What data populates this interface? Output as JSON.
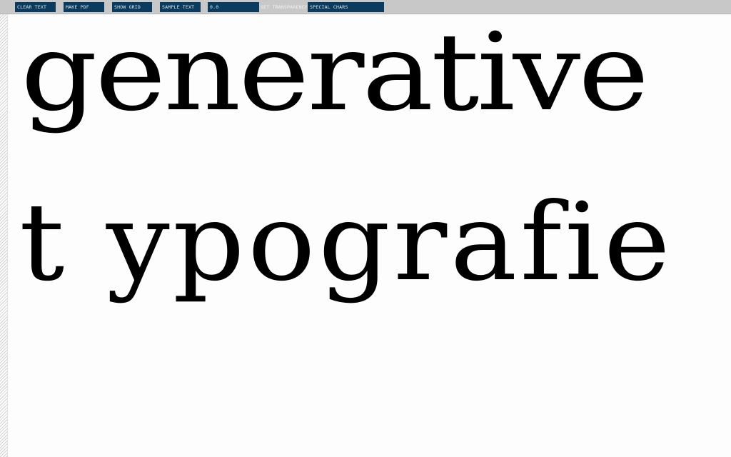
{
  "toolbar": {
    "clear_text": "CLEAR TEXT",
    "make_pdf": "MAKE PDF",
    "show_grid": "SHOW GRID",
    "sample_text": "SAMPLE TEXT",
    "transparency_value": "0.0",
    "set_transparency": "SET TRANSPARENCY",
    "special_chars": "SPECIAL CHARS"
  },
  "canvas": {
    "line_1": "generative",
    "line_2": "t ypografie"
  },
  "colors": {
    "toolbar_background": "#c8c8c8",
    "button_background": "#0b3b5e",
    "button_text": "#dfe8ef",
    "canvas_background": "#fdfdfd",
    "type_color": "#000000"
  }
}
